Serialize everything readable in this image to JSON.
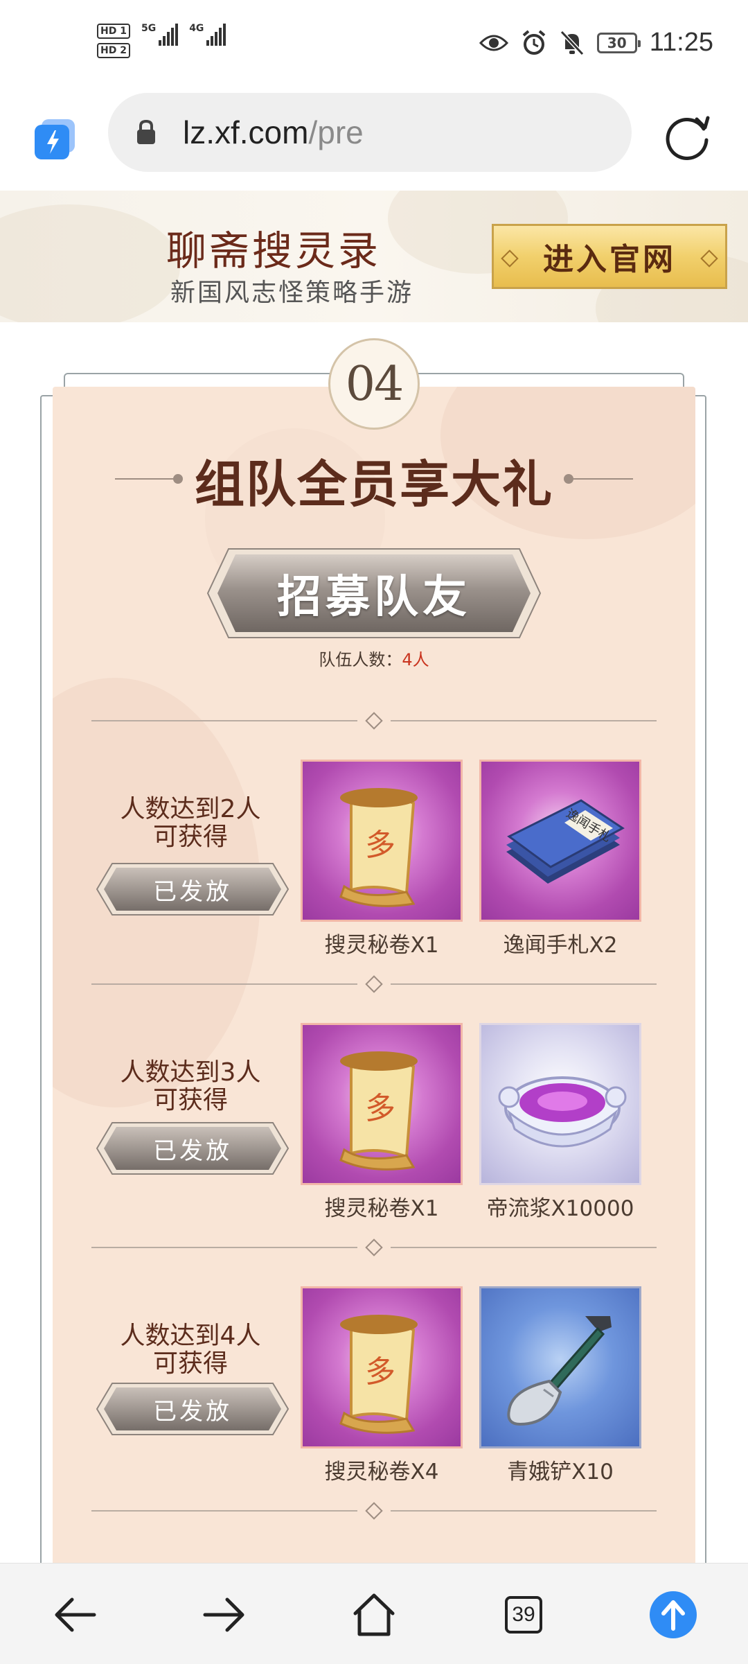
{
  "status_bar": {
    "time": "11:25",
    "battery": "30",
    "sim1_badge": "HD 1",
    "sim2_badge": "HD 2",
    "network1": "5G",
    "network2": "4G",
    "icons": [
      "eye-icon",
      "alarm-icon",
      "bell-off-icon",
      "battery-icon"
    ]
  },
  "browser": {
    "url_domain": "lz.xf.com",
    "url_path": "/pre",
    "tab_count": "39"
  },
  "banner": {
    "title": "聊斋搜灵录",
    "subtitle": "新国风志怪策略手游",
    "enter_button": "进入官网"
  },
  "panel": {
    "step_number": "04",
    "section_title": "组队全员享大礼",
    "recruit_button": "招募队友",
    "team_count_label": "队伍人数：",
    "team_count_value": "4人",
    "tiers": [
      {
        "label_line1": "人数达到2人",
        "label_line2": "可获得",
        "status": "已发放",
        "rewards": [
          {
            "name": "搜灵秘卷X1",
            "icon": "scroll-icon"
          },
          {
            "name": "逸闻手札X2",
            "icon": "book-icon"
          }
        ]
      },
      {
        "label_line1": "人数达到3人",
        "label_line2": "可获得",
        "status": "已发放",
        "rewards": [
          {
            "name": "搜灵秘卷X1",
            "icon": "scroll-icon"
          },
          {
            "name": "帝流浆X10000",
            "icon": "jade-bowl-icon"
          }
        ]
      },
      {
        "label_line1": "人数达到4人",
        "label_line2": "可获得",
        "status": "已发放",
        "rewards": [
          {
            "name": "搜灵秘卷X4",
            "icon": "scroll-icon"
          },
          {
            "name": "青娥铲X10",
            "icon": "shovel-icon"
          }
        ]
      }
    ]
  },
  "colors": {
    "panel_bg": "#f9e5d6",
    "title_brown": "#5c2c1c",
    "accent_red": "#c9341f",
    "gold": "#f1d06c",
    "browser_blue": "#2f8cf5"
  }
}
